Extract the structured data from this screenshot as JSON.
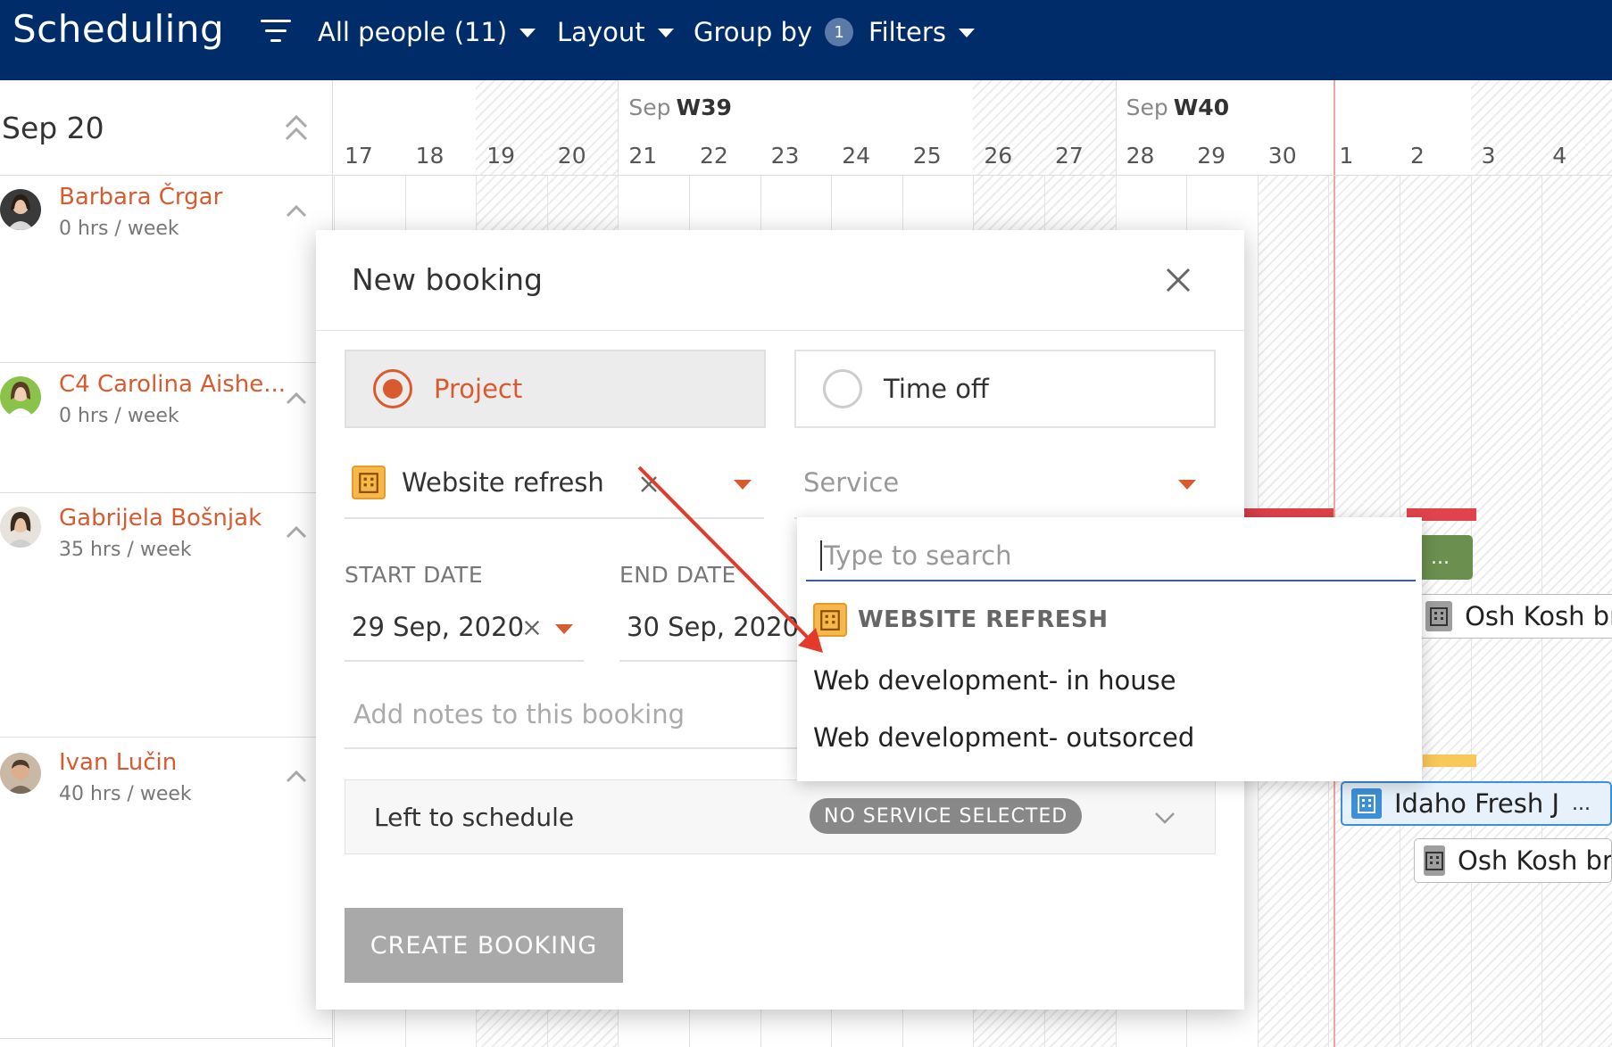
{
  "topbar": {
    "title": "Scheduling",
    "people_filter": "All people (11)",
    "layout": "Layout",
    "group_by": "Group by",
    "group_by_count": "1",
    "filters": "Filters"
  },
  "calendar": {
    "current_date": "Sep 20",
    "weeks": [
      {
        "month": "Sep",
        "week": "W39"
      },
      {
        "month": "Sep",
        "week": "W40"
      }
    ],
    "days": [
      "17",
      "18",
      "19",
      "20",
      "21",
      "22",
      "23",
      "24",
      "25",
      "26",
      "27",
      "28",
      "29",
      "30",
      "1",
      "2",
      "3",
      "4"
    ]
  },
  "people": [
    {
      "name": "Barbara Črgar",
      "hours": "0 hrs / week"
    },
    {
      "name": "C4 Carolina Aishe...",
      "hours": "0 hrs / week"
    },
    {
      "name": "Gabrijela Bošnjak",
      "hours": "35 hrs / week"
    },
    {
      "name": "Ivan Lučin",
      "hours": "40 hrs / week"
    }
  ],
  "bookings": {
    "green_chip": "...",
    "osh_kosh_1": "Osh Kosh br",
    "idaho": "Idaho Fresh J",
    "idaho_more": "...",
    "osh_kosh_2": "Osh Kosh br"
  },
  "modal": {
    "title": "New booking",
    "type_project": "Project",
    "type_timeoff": "Time off",
    "project_value": "Website refresh",
    "service_placeholder": "Service",
    "start_label": "START DATE",
    "start_value": "29 Sep, 2020",
    "end_label": "END DATE",
    "end_value": "30 Sep, 2020",
    "notes_placeholder": "Add notes to this booking",
    "left_to_schedule": "Left to schedule",
    "no_service_badge": "NO SERVICE SELECTED",
    "create_button": "CREATE BOOKING"
  },
  "dropdown": {
    "search_placeholder": "Type to search",
    "group_label": "WEBSITE REFRESH",
    "options": [
      "Web development- in house",
      "Web development- outsorced"
    ]
  },
  "colors": {
    "topbar": "#002d6a",
    "accent": "#d85b30",
    "project_icon": "#f6b84a",
    "bar_red": "#e0434c",
    "bar_yellow": "#f8c85a",
    "chip_green": "#6a8f4e",
    "chip_blue": "#3c8fd9"
  }
}
